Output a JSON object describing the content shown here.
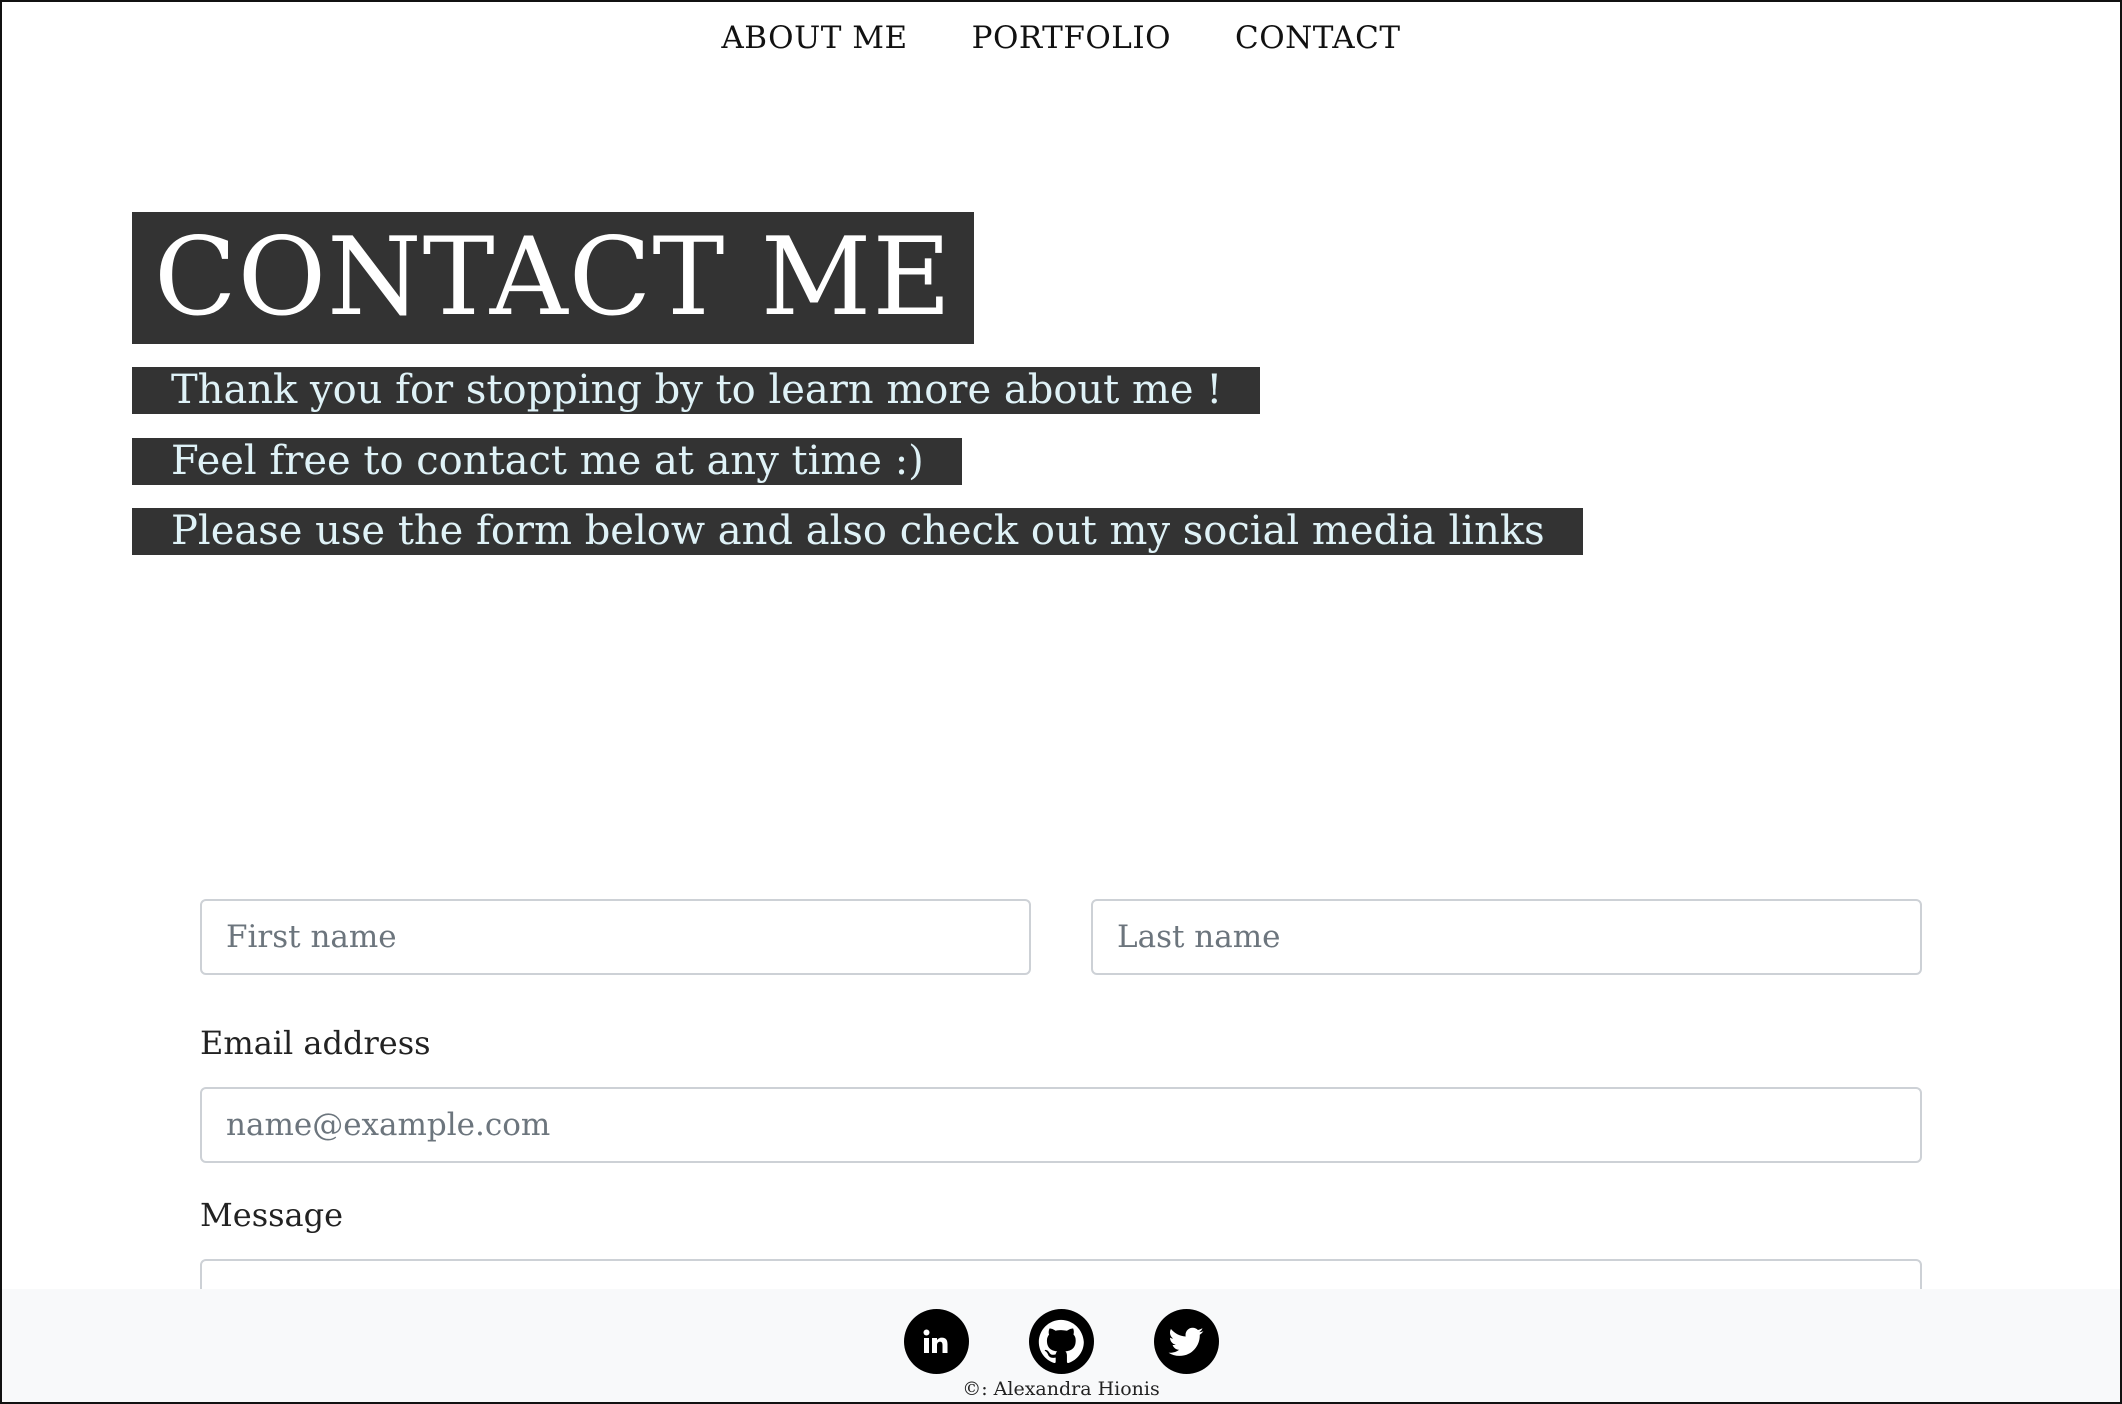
{
  "nav": {
    "items": [
      {
        "label": "ABOUT ME"
      },
      {
        "label": "PORTFOLIO"
      },
      {
        "label": "CONTACT"
      }
    ]
  },
  "hero": {
    "title": "CONTACT ME",
    "lines": [
      "Thank you for stopping by to learn more about me !",
      "Feel free to contact me at any time :)",
      "Please use the form below and also check out my social media links"
    ]
  },
  "form": {
    "first_name": {
      "placeholder": "First name",
      "value": ""
    },
    "last_name": {
      "placeholder": "Last name",
      "value": ""
    },
    "email": {
      "label": "Email address",
      "placeholder": "name@example.com",
      "value": ""
    },
    "message": {
      "label": "Message",
      "value": ""
    }
  },
  "footer": {
    "social": [
      {
        "icon": "linkedin-icon"
      },
      {
        "icon": "github-icon"
      },
      {
        "icon": "twitter-icon"
      }
    ],
    "copyright_symbol": "©:",
    "copyright_name": "Alexandra Hionis"
  },
  "colors": {
    "hero_bg": "#333333",
    "hero_title_text": "#ffffff",
    "hero_line_text": "#dff2f7",
    "footer_bg": "#f8f9fa",
    "social_icon_bg": "#000000"
  }
}
